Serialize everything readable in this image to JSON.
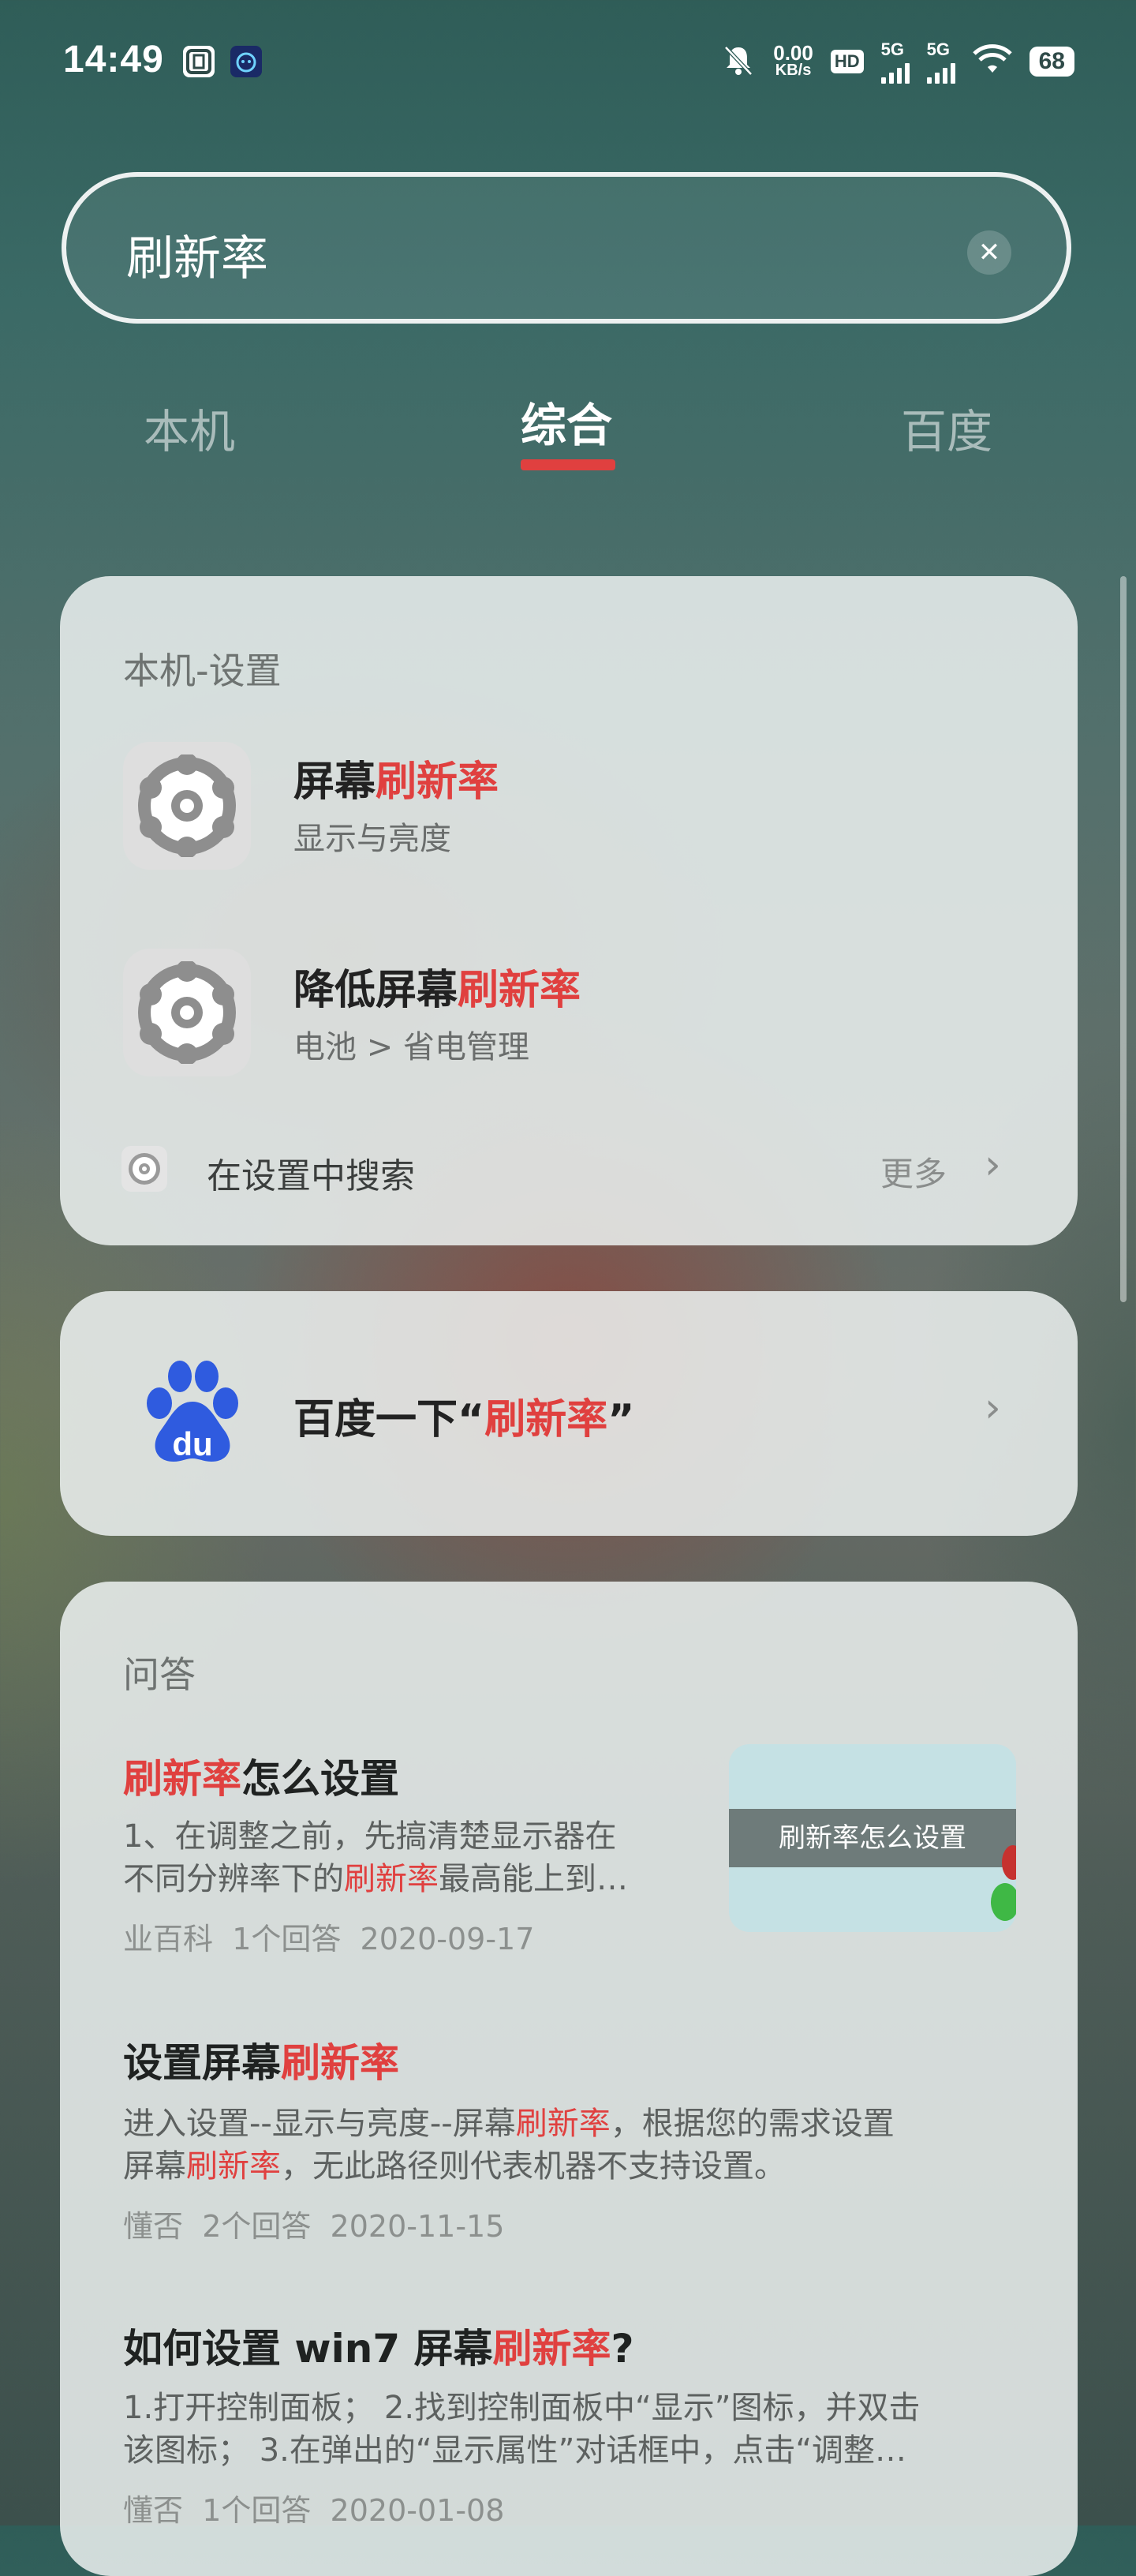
{
  "status_bar": {
    "time": "14:49",
    "net_speed_value": "0.00",
    "net_speed_unit": "KB/s",
    "hd_label": "HD",
    "sim1_label": "5G",
    "sim2_label": "5G",
    "battery": "68"
  },
  "search": {
    "query": "刷新率"
  },
  "tabs": [
    {
      "label": "本机"
    },
    {
      "label": "综合",
      "active": true
    },
    {
      "label": "百度"
    }
  ],
  "settings_card": {
    "title": "本机-设置",
    "items": [
      {
        "title_plain": "屏幕",
        "title_hl": "刷新率",
        "subtitle": "显示与亮度"
      },
      {
        "title_plain": "降低屏幕",
        "title_hl": "刷新率",
        "subtitle": "电池 > 省电管理"
      }
    ],
    "search_in_settings": "在设置中搜索",
    "more": "更多"
  },
  "baidu_card": {
    "prefix": "百度一下“",
    "query": "刷新率",
    "suffix": "”",
    "logo_text": "du"
  },
  "qa_card": {
    "title": "问答",
    "items": [
      {
        "title_parts": [
          {
            "t": "刷新率",
            "hl": true
          },
          {
            "t": "怎么设置",
            "hl": false
          }
        ],
        "body_line1": [
          {
            "t": "1、在调整之前，先搞清楚显示器在",
            "hl": false
          }
        ],
        "body_line2": [
          {
            "t": "不同分辨率下的",
            "hl": false
          },
          {
            "t": "刷新率",
            "hl": true
          },
          {
            "t": "最高能上到…",
            "hl": false
          }
        ],
        "source": "业百科",
        "answers": "1个回答",
        "date": "2020-09-17",
        "thumb_caption": "刷新率怎么设置"
      },
      {
        "title_parts": [
          {
            "t": "设置屏幕",
            "hl": false
          },
          {
            "t": "刷新率",
            "hl": true
          }
        ],
        "body_line1": [
          {
            "t": "进入设置--显示与亮度--屏幕",
            "hl": false
          },
          {
            "t": "刷新率",
            "hl": true
          },
          {
            "t": "，根据您的需求设置",
            "hl": false
          }
        ],
        "body_line2": [
          {
            "t": "屏幕",
            "hl": false
          },
          {
            "t": "刷新率",
            "hl": true
          },
          {
            "t": "，无此路径则代表机器不支持设置。",
            "hl": false
          }
        ],
        "source": "懂否",
        "answers": "2个回答",
        "date": "2020-11-15"
      },
      {
        "title_parts": [
          {
            "t": "如何设置 win7 屏幕",
            "hl": false
          },
          {
            "t": "刷新率",
            "hl": true
          },
          {
            "t": "?",
            "hl": false
          }
        ],
        "body_line1": [
          {
            "t": "1.打开控制面板； 2.找到控制面板中“显示”图标，并双击",
            "hl": false
          }
        ],
        "body_line2": [
          {
            "t": "该图标； 3.在弹出的“显示属性”对话框中，点击“调整…",
            "hl": false
          }
        ],
        "source": "懂否",
        "answers": "1个回答",
        "date": "2020-01-08"
      }
    ]
  },
  "colors": {
    "highlight": "#e0403f",
    "baidu_blue": "#2f5bdf"
  }
}
